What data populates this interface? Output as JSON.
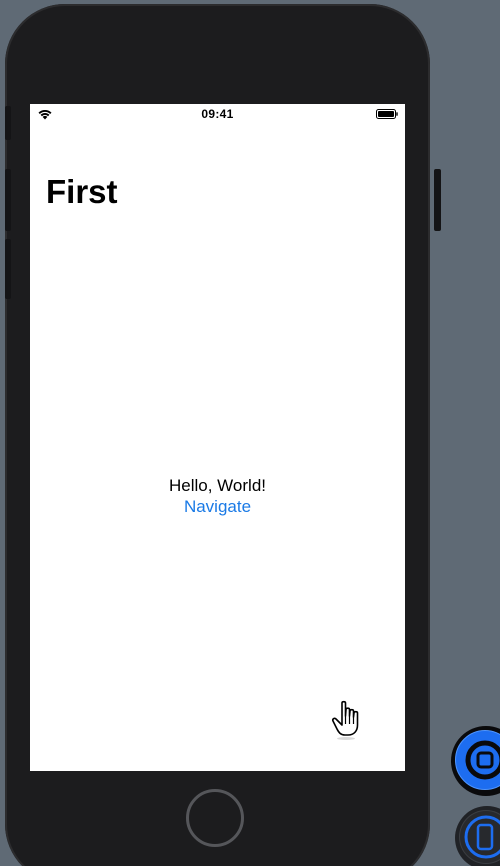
{
  "status_bar": {
    "time": "09:41",
    "wifi_icon": "wifi-icon",
    "battery_icon": "battery-icon"
  },
  "navigation": {
    "title": "First"
  },
  "content": {
    "text": "Hello, World!",
    "link_label": "Navigate"
  },
  "colors": {
    "link": "#1a7ae6",
    "desktop": "#5f6a75",
    "device_body": "#1c1c1e",
    "accent_button": "#1d6df0"
  },
  "icons": {
    "cursor": "pointer-hand-icon",
    "home_button": "home-button",
    "record_button": "stop-record-icon",
    "device_button": "device-icon"
  }
}
